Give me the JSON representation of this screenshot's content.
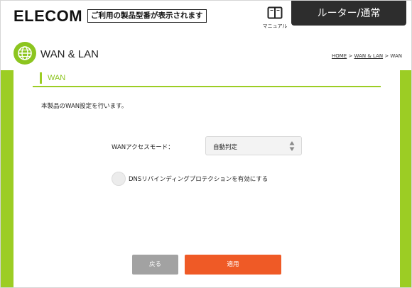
{
  "header": {
    "logo": "ELECOM",
    "product_tag": "ご利用の製品型番が表示されます",
    "manual_label": "マニュアル",
    "mode_button": "ルーター/通常"
  },
  "title_bar": {
    "title": "WAN & LAN",
    "breadcrumb": {
      "home": "HOME",
      "sep1": " > ",
      "wan_lan": "WAN & LAN",
      "sep2": " > ",
      "current": "WAN"
    }
  },
  "content": {
    "section_title": "WAN",
    "description": "本製品のWAN設定を行います。",
    "wan_mode_label": "WANアクセスモード：",
    "wan_mode_value": "自動判定",
    "dns_rebinding_label": "DNSリバインディングプロテクションを有効にする",
    "dns_rebinding_checked": false
  },
  "buttons": {
    "back": "戻る",
    "apply": "適用"
  },
  "colors": {
    "accent_green": "#9ccd24",
    "apply_orange": "#ef5a26",
    "back_gray": "#a2a2a2",
    "dark_button": "#2d2d2d"
  },
  "icons": {
    "manual": "book-icon",
    "page": "globe-icon",
    "select": "updown-arrows-icon"
  }
}
